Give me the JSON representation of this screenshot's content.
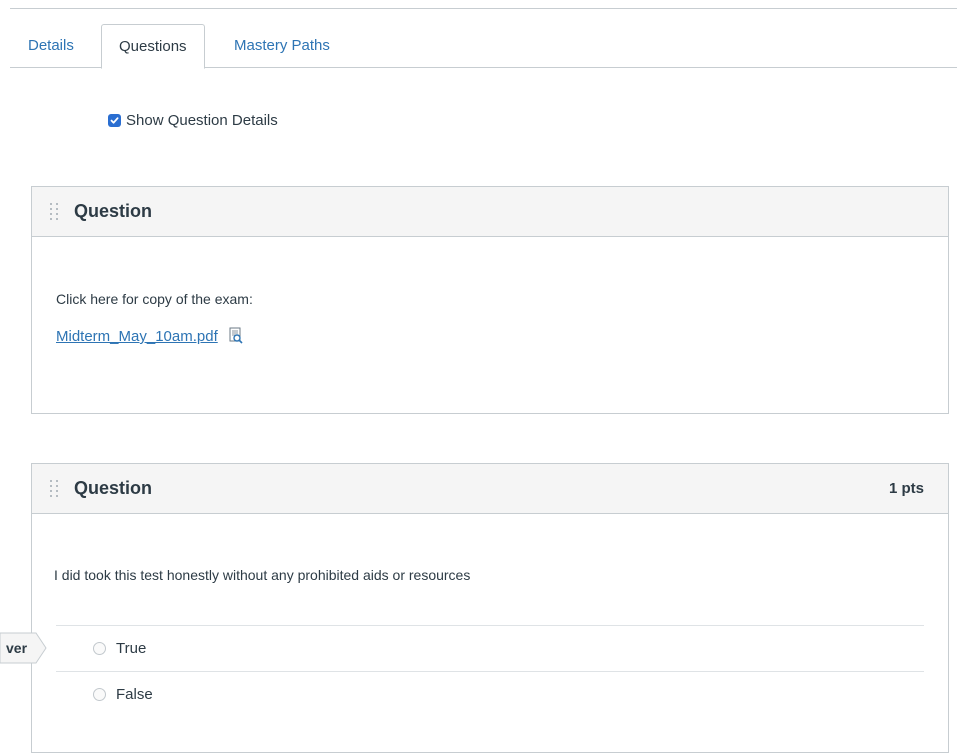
{
  "tabs": [
    {
      "label": "Details"
    },
    {
      "label": "Questions"
    },
    {
      "label": "Mastery Paths"
    }
  ],
  "show_details": {
    "label": "Show Question Details",
    "checked": true
  },
  "questions": [
    {
      "title": "Question",
      "points": "",
      "text": "Click here for copy of the exam:",
      "file_link": "Midterm_May_10am.pdf",
      "file_icon": "document-preview-icon"
    },
    {
      "title": "Question",
      "points": "1 pts",
      "text": "I did took this test honestly without any prohibited aids or resources",
      "answers": [
        {
          "label": "True"
        },
        {
          "label": "False"
        }
      ],
      "answer_arrow_label": "ver"
    }
  ],
  "colors": {
    "link": "#2d74b4",
    "text": "#2d3b45",
    "border": "#c7cdd1",
    "header_bg": "#f5f5f5",
    "checkbox": "#2a6ed1"
  }
}
